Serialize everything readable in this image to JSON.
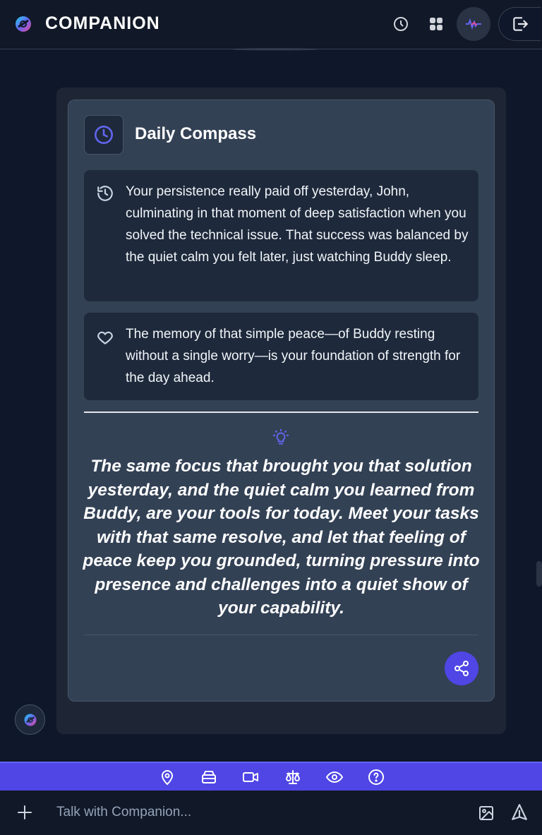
{
  "header": {
    "title": "COMPANION",
    "icons": [
      "app-logo-icon",
      "history-icon",
      "grid-icon",
      "avatar",
      "logout-icon"
    ]
  },
  "card": {
    "title": "Daily Compass",
    "notes": [
      {
        "icon": "history-icon",
        "text": "Your persistence really paid off yesterday, John, culminating in that moment of deep satisfaction when you solved the technical issue. That success was balanced by the quiet calm you felt later, just watching Buddy sleep."
      },
      {
        "icon": "heart-icon",
        "text": "The memory of that simple peace—of Buddy resting without a single worry—is your foundation of strength for the day ahead."
      }
    ],
    "quote": "The same focus that brought you that solution yesterday, and the quiet calm you learned from Buddy, are your tools for today. Meet your tasks with that same resolve, and let that feeling of peace keep you grounded, turning pressure into presence and challenges into a quiet show of your capability."
  },
  "toolbar": {
    "tools": [
      "location-icon",
      "archive-icon",
      "video-icon",
      "scales-icon",
      "eye-icon",
      "help-icon"
    ]
  },
  "input": {
    "placeholder": "Talk with Companion..."
  },
  "colors": {
    "background": "#0f172a",
    "card": "#334155",
    "note": "#1e293b",
    "accent": "#4f46e5"
  }
}
